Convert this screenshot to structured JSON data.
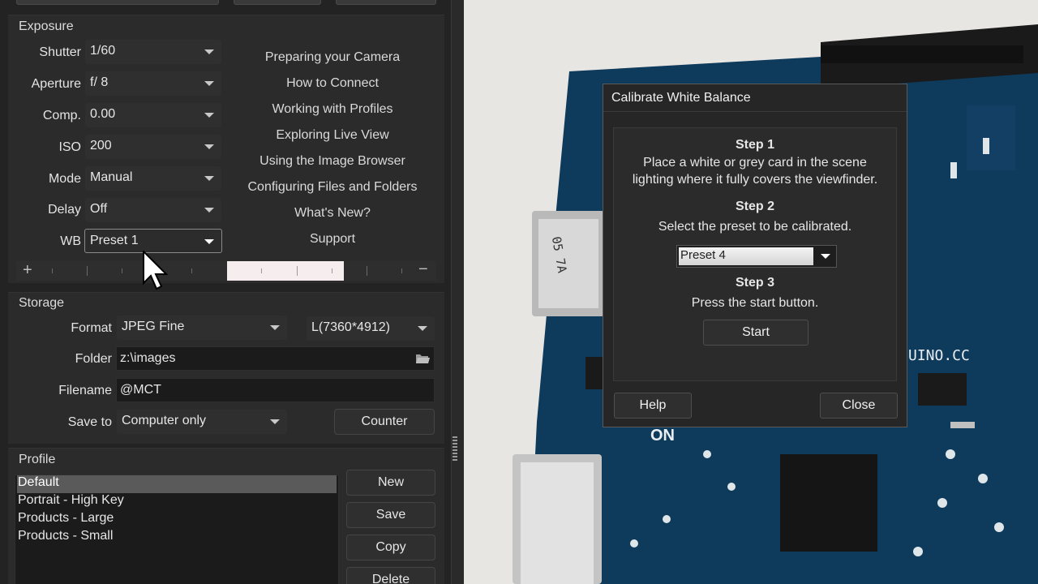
{
  "colors": {
    "panel_bg": "#232323",
    "field_bg": "#1b1b1b",
    "selection": "#5a5a5a",
    "dialog_bg": "#262626"
  },
  "exposure": {
    "title": "Exposure",
    "fields": [
      {
        "label": "Shutter",
        "value": "1/60"
      },
      {
        "label": "Aperture",
        "value": "f/ 8"
      },
      {
        "label": "Comp.",
        "value": "0.00"
      },
      {
        "label": "ISO",
        "value": "200"
      },
      {
        "label": "Mode",
        "value": "Manual"
      },
      {
        "label": "Delay",
        "value": "Off"
      },
      {
        "label": "WB",
        "value": "Preset 1"
      }
    ],
    "links": [
      "Preparing your Camera",
      "How to Connect",
      "Working with Profiles",
      "Exploring Live View",
      "Using the Image Browser",
      "Configuring Files and Folders",
      "What's New?",
      "Support"
    ],
    "slider": {
      "plus": "+",
      "minus": "−"
    }
  },
  "storage": {
    "title": "Storage",
    "format_label": "Format",
    "format_value": "JPEG Fine",
    "size_value": "L(7360*4912)",
    "folder_label": "Folder",
    "folder_value": "z:\\images",
    "filename_label": "Filename",
    "filename_value": "@MCT",
    "saveto_label": "Save to",
    "saveto_value": "Computer only",
    "counter_button": "Counter"
  },
  "profile": {
    "title": "Profile",
    "items": [
      "Default",
      "Portrait - High Key",
      "Products - Large",
      "Products - Small"
    ],
    "selected_index": 0,
    "buttons": {
      "new": "New",
      "save": "Save",
      "copy": "Copy",
      "delete": "Delete"
    }
  },
  "dialog": {
    "title": "Calibrate White Balance",
    "step1_title": "Step 1",
    "step1_line1": "Place a white or grey card in the scene",
    "step1_line2": "lighting where it fully covers the viewfinder.",
    "step2_title": "Step 2",
    "step2_text": "Select the preset to be calibrated.",
    "preset_value": "Preset 4",
    "step3_title": "Step 3",
    "step3_text": "Press the start button.",
    "start_button": "Start",
    "help_button": "Help",
    "close_button": "Close"
  },
  "live_view": {
    "board_text_1": "UINO.CC",
    "board_text_2": "ON",
    "board_text_3": "05 7A"
  }
}
